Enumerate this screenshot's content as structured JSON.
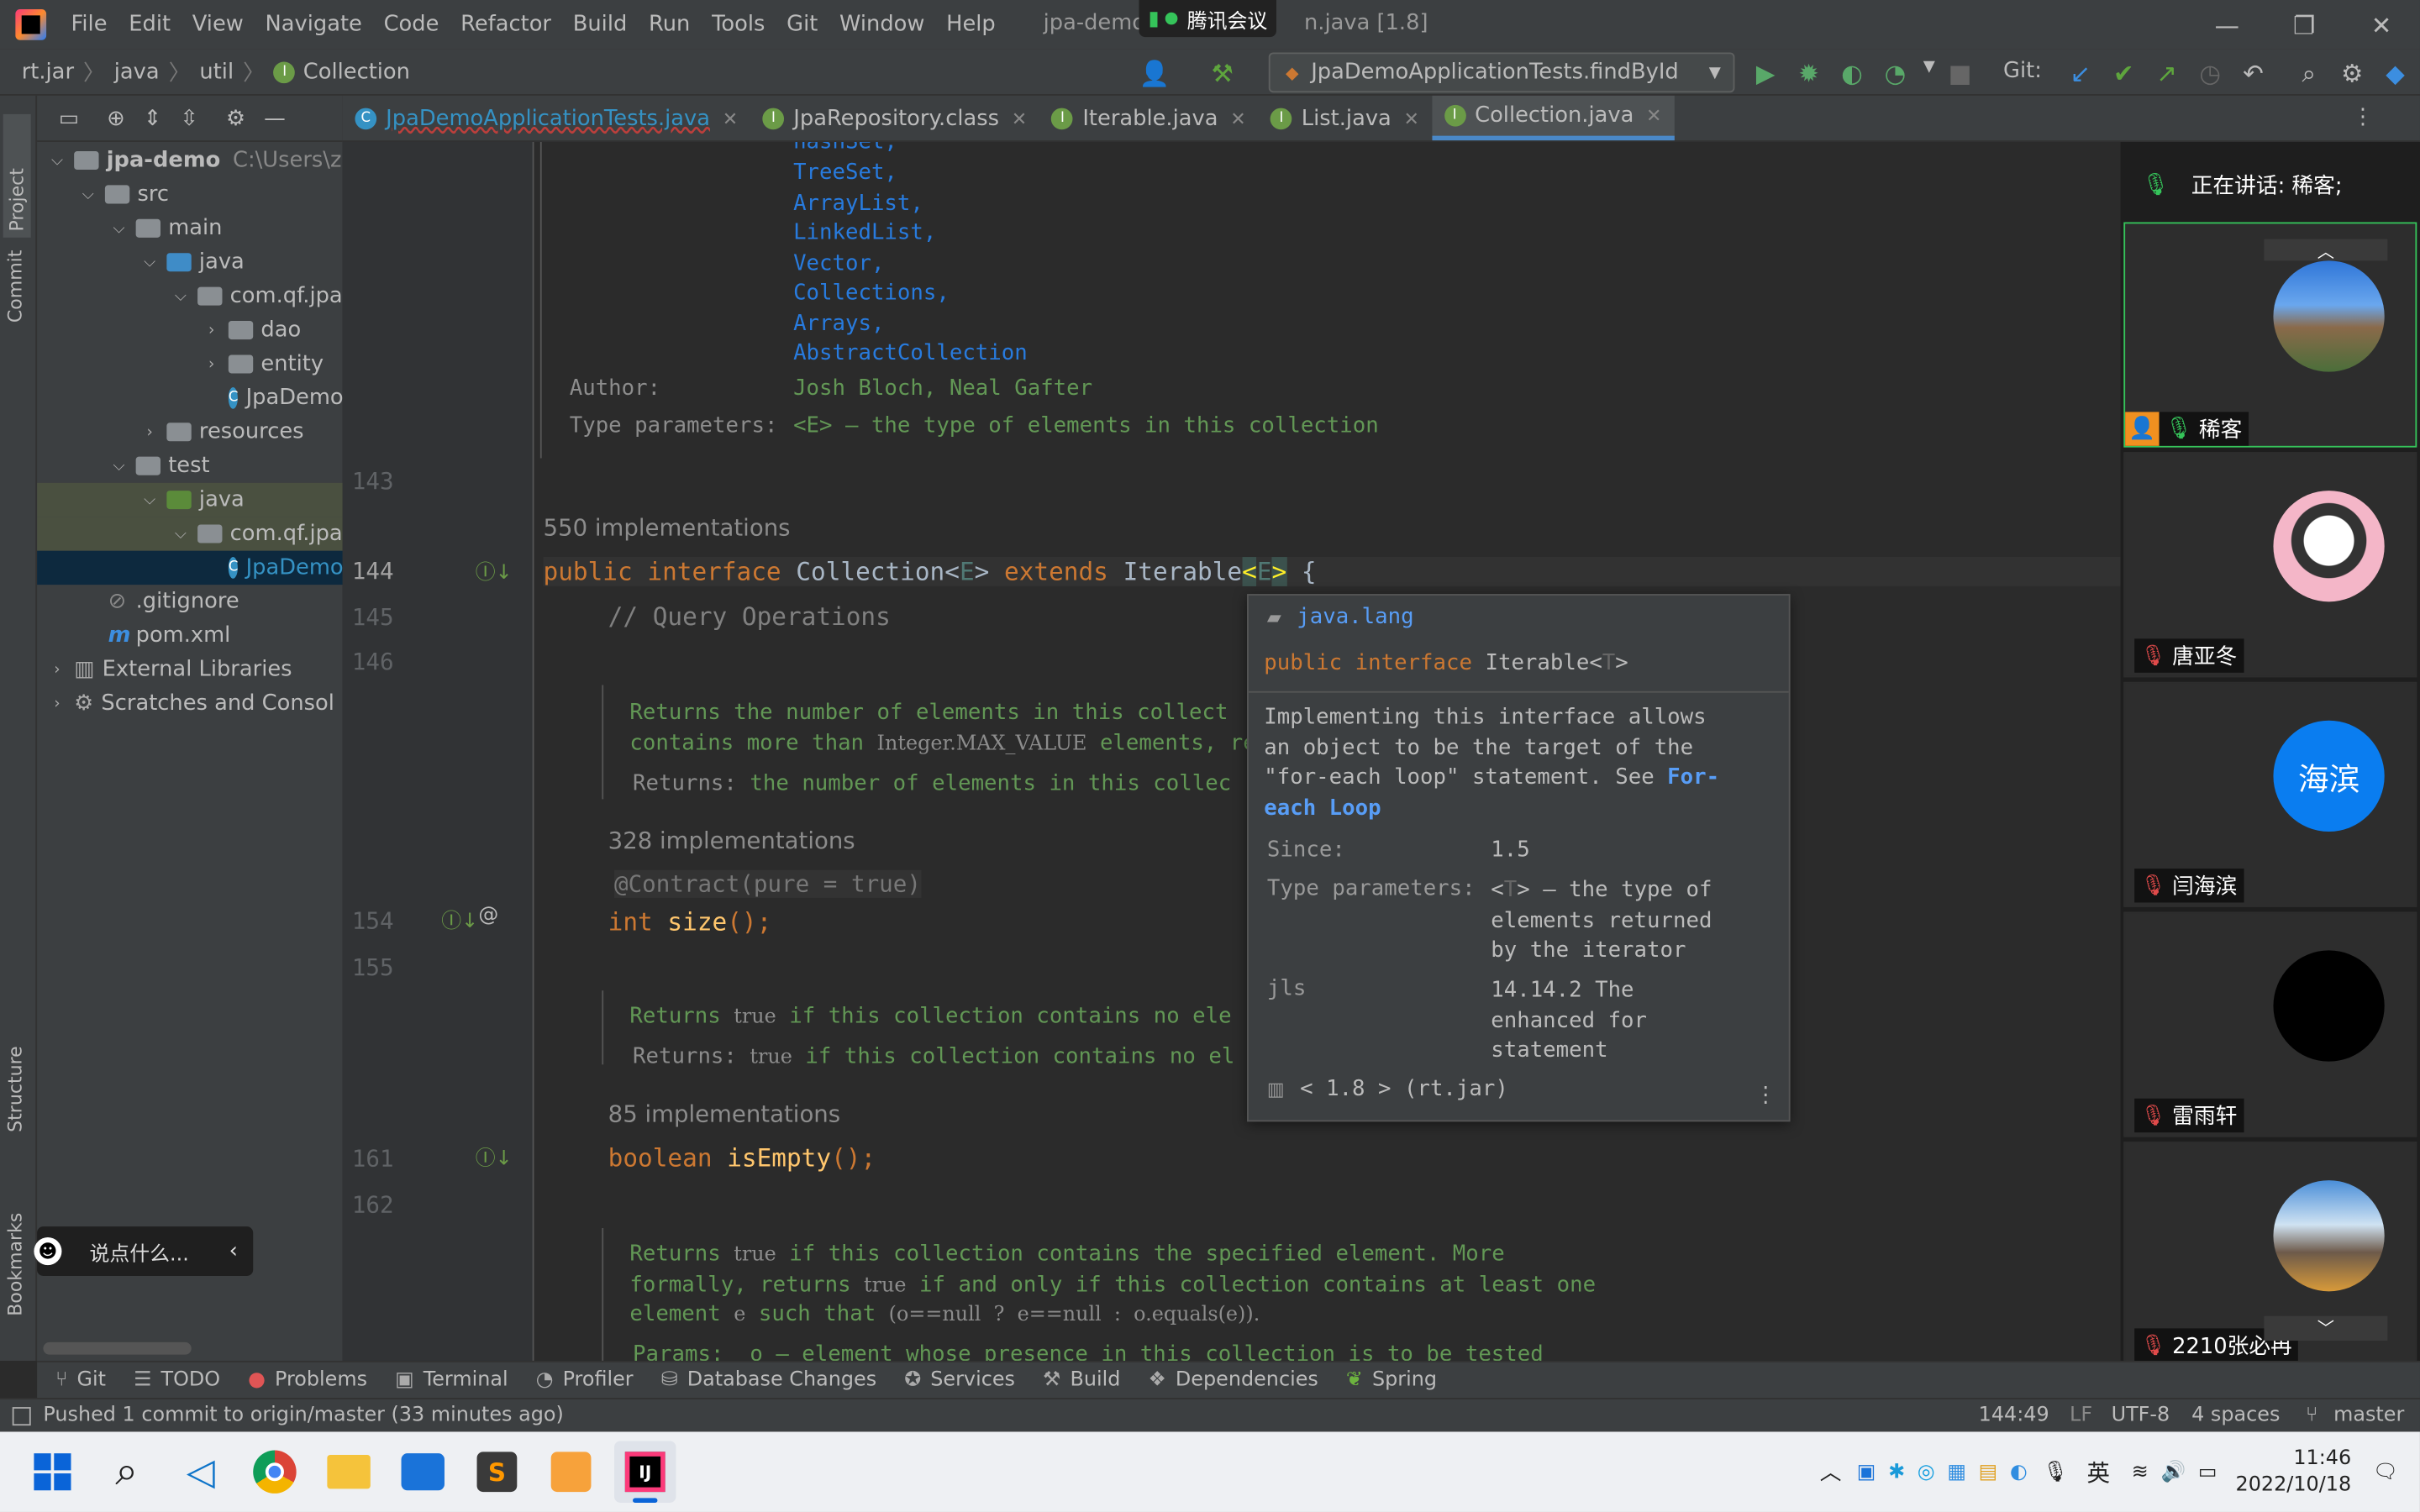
{
  "window": {
    "title": "jpa-demo",
    "title_suffix": "n.java [1.8]",
    "meeting_app": "腾讯会议",
    "menu": [
      "File",
      "Edit",
      "View",
      "Navigate",
      "Code",
      "Refactor",
      "Build",
      "Run",
      "Tools",
      "Git",
      "Window",
      "Help"
    ]
  },
  "breadcrumbs": [
    "rt.jar",
    "java",
    "util",
    "Collection"
  ],
  "run_config": "JpaDemoApplicationTests.findById",
  "git_label": "Git:",
  "tabs": [
    {
      "label": "JpaDemoApplicationTests.java",
      "color": "#3592c4"
    },
    {
      "label": "JpaRepository.class",
      "color": "#6b9b47"
    },
    {
      "label": "Iterable.java",
      "color": "#6b9b47"
    },
    {
      "label": "List.java",
      "color": "#6b9b47"
    },
    {
      "label": "Collection.java",
      "color": "#6b9b47",
      "active": true
    }
  ],
  "project_tree": [
    {
      "label": "jpa-demo",
      "extra": "C:\\Users\\z"
    },
    {
      "label": "src"
    },
    {
      "label": "main"
    },
    {
      "label": "java"
    },
    {
      "label": "com.qf.jpa"
    },
    {
      "label": "dao"
    },
    {
      "label": "entity"
    },
    {
      "label": "JpaDemo"
    },
    {
      "label": "resources"
    },
    {
      "label": "test"
    },
    {
      "label": "java"
    },
    {
      "label": "com.qf.jpa"
    },
    {
      "label": "JpaDemo"
    },
    {
      "label": ".gitignore"
    },
    {
      "label": "pom.xml"
    },
    {
      "label": "External Libraries"
    },
    {
      "label": "Scratches and Consol"
    }
  ],
  "side_labels": {
    "project": "Project",
    "commit": "Commit",
    "structure": "Structure",
    "bookmarks": "Bookmarks"
  },
  "editor": {
    "see_list": [
      "hashSet,",
      "TreeSet,",
      "ArrayList,",
      "LinkedList,",
      "Vector,",
      "Collections,",
      "Arrays,",
      "AbstractCollection"
    ],
    "author_label": "Author:",
    "author_value": "Josh Bloch, Neal Gafter",
    "typeparams_label": "Type parameters:",
    "typeparams_value": "<E> – the type of elements in this collection",
    "impl_550": "550 implementations",
    "decl_public": "public ",
    "decl_interface": "interface ",
    "decl_name": "Collection<",
    "decl_E": "E",
    "decl_close": "> ",
    "decl_extends": "extends ",
    "decl_iterable": "Iterable",
    "decl_lt": "<",
    "decl_E2": "E",
    "decl_gt": ">",
    "decl_brace": " {",
    "comment_query": "// Query Operations",
    "doc_size_1": "Returns the number of elements in this collect",
    "doc_size_2a": "contains more than ",
    "doc_size_2b": "Integer.MAX_VALUE",
    "doc_size_2c": " elements, re",
    "doc_size_returns_label": "Returns:",
    "doc_size_returns": " the number of elements in this collec",
    "impl_328": "328 implementations",
    "contract": "@Contract(pure = true)",
    "size_type": "int ",
    "size_name": "size",
    "size_end": "();",
    "doc_empty_1a": "Returns ",
    "doc_empty_1b": "true",
    "doc_empty_1c": " if this collection contains no ele",
    "doc_empty_returns_label": "Returns:",
    "doc_empty_returns_b": "true",
    "doc_empty_returns_c": " if this collection contains no el",
    "impl_85": "85 implementations",
    "empty_type": "boolean ",
    "empty_name": "isEmpty",
    "empty_end": "();",
    "doc_contains_1a": "Returns ",
    "doc_contains_1b": "true",
    "doc_contains_1c": " if this collection contains the specified element. More",
    "doc_contains_2a": "formally, returns ",
    "doc_contains_2b": "true",
    "doc_contains_2c": " if and only if this collection contains at least one",
    "doc_contains_3a": "element ",
    "doc_contains_3b": "e",
    "doc_contains_3c": " such that ",
    "doc_contains_3d": "(o==null  ?  e==null  :  o.equals(e)).",
    "doc_contains_4": "Params:  o – element whose presence in this collection is to be tested",
    "line_numbers": {
      "l143": "143",
      "l144": "144",
      "l145": "145",
      "l146": "146",
      "l154": "154",
      "l155": "155",
      "l161": "161",
      "l162": "162"
    }
  },
  "popup": {
    "package": "java.lang",
    "sig_public": "public ",
    "sig_interface": "interface ",
    "sig_name": "Iterable<",
    "sig_T": "T",
    "sig_gt": ">",
    "desc_1": "Implementing this interface allows",
    "desc_2": "an object to be the target of the",
    "desc_3": "\"for-each loop\" statement. See ",
    "desc_link1": "For-",
    "desc_link2": "each Loop",
    "since_label": "Since:",
    "since_value": "1.5",
    "tp_label": "Type parameters:",
    "tp_T": "T",
    "tp_value_1": "> – the type of",
    "tp_value_2": "elements returned",
    "tp_value_3": "by the iterator",
    "jls_label": "jls",
    "jls_1": "14.14.2 The",
    "jls_2": "enhanced for",
    "jls_3": "statement",
    "footer": "< 1.8 > (rt.jar)"
  },
  "meeting": {
    "speaking": "正在讲话: 稀客;",
    "participants": [
      {
        "name": "稀客"
      },
      {
        "name": "唐亚冬"
      },
      {
        "name": "闫海滨",
        "initials": "海滨"
      },
      {
        "name": "雷雨轩"
      },
      {
        "name": "2210张必冉"
      }
    ]
  },
  "chat_placeholder": "说点什么...",
  "bottom_tools": [
    "Git",
    "TODO",
    "Problems",
    "Terminal",
    "Profiler",
    "Database Changes",
    "Services",
    "Build",
    "Dependencies",
    "Spring"
  ],
  "status": {
    "message": "Pushed 1 commit to origin/master (33 minutes ago)",
    "position": "144:49",
    "line_sep": "LF",
    "encoding": "UTF-8",
    "indent": "4 spaces",
    "branch": "master"
  },
  "taskbar": {
    "ime": "英",
    "time": "11:46",
    "date": "2022/10/18"
  }
}
